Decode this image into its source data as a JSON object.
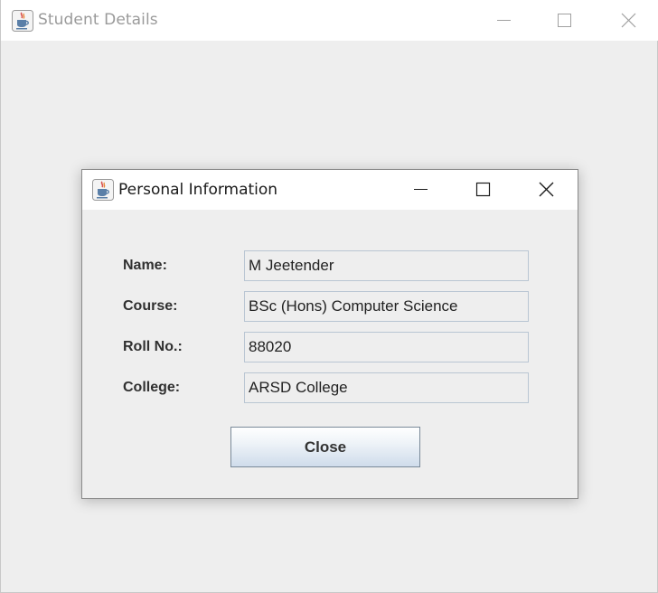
{
  "outer_window": {
    "title": "Student Details"
  },
  "dialog": {
    "title": "Personal Information",
    "fields": [
      {
        "label": "Name:",
        "value": "M Jeetender"
      },
      {
        "label": "Course:",
        "value": "BSc (Hons) Computer Science"
      },
      {
        "label": "Roll No.:",
        "value": "88020"
      },
      {
        "label": "College:",
        "value": "ARSD College"
      }
    ],
    "close_label": "Close"
  },
  "icons": {
    "app": "java-cup-icon",
    "minimize": "minimize-icon",
    "maximize": "maximize-icon",
    "close": "close-icon"
  },
  "colors": {
    "window_bg": "#eeeeee",
    "titlebar_bg": "#ffffff",
    "field_border": "#b9c6d3",
    "button_gradient_bottom": "#cfdceb"
  }
}
